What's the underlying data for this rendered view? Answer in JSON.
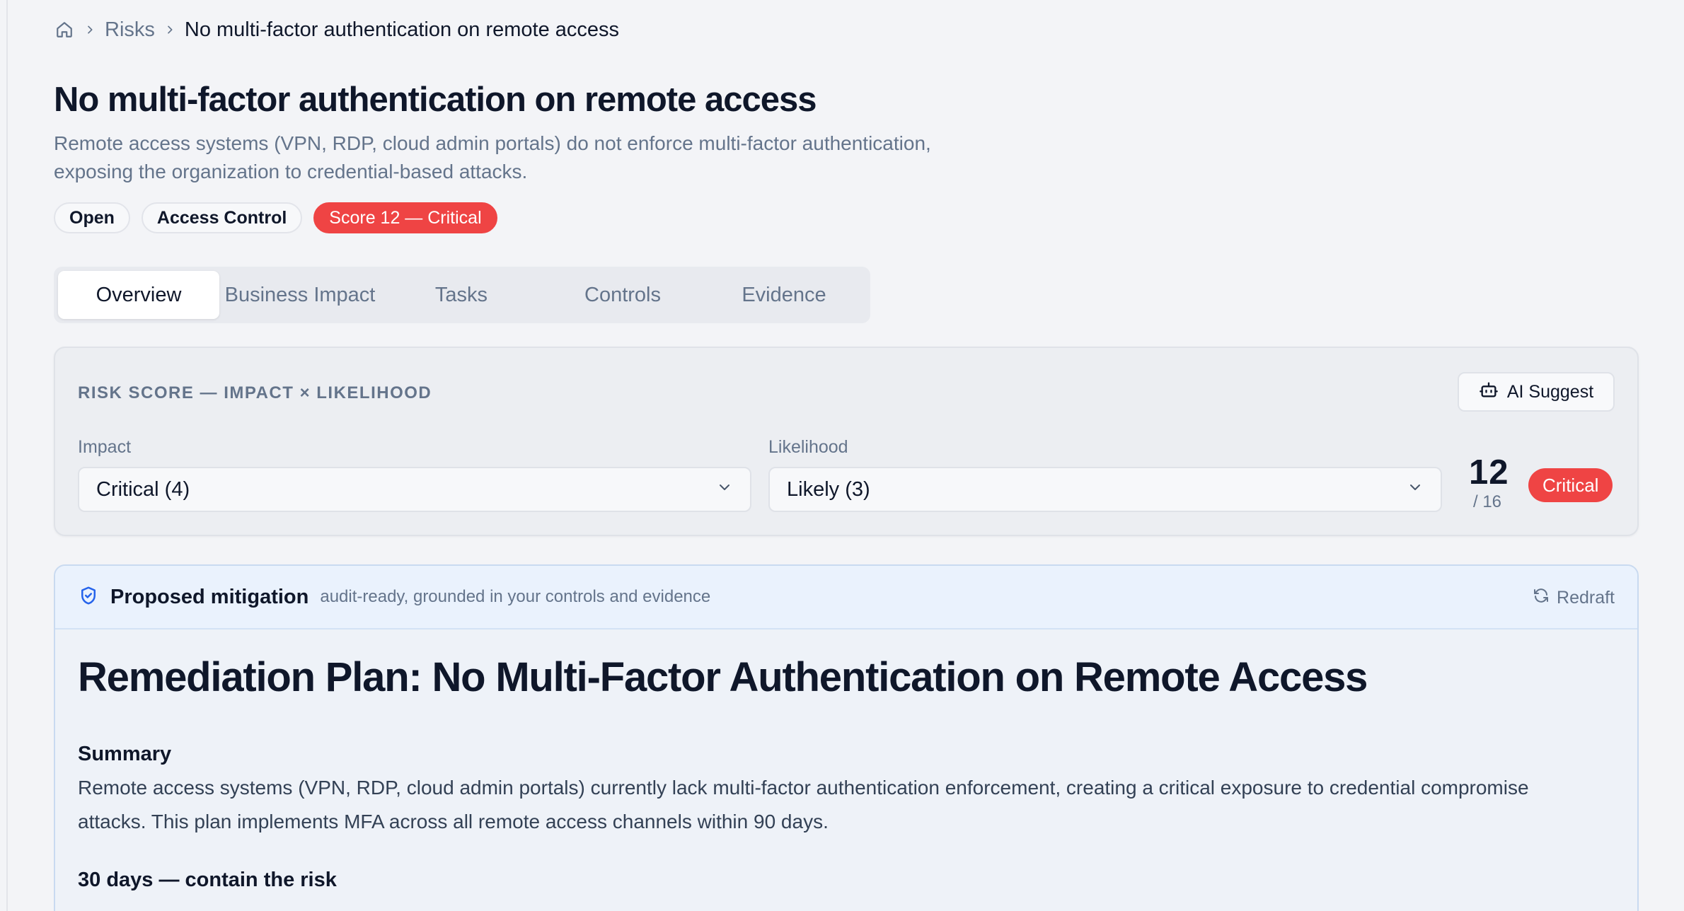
{
  "breadcrumb": {
    "home_icon": "home-icon",
    "items": [
      "Risks"
    ],
    "current": "No multi-factor authentication on remote access"
  },
  "risk": {
    "title": "No multi-factor authentication on remote access",
    "description": "Remote access systems (VPN, RDP, cloud admin portals) do not enforce multi-factor authentication, exposing the organization to credential-based attacks.",
    "badges": {
      "status": "Open",
      "category": "Access Control",
      "score": "Score 12 — Critical"
    }
  },
  "tabs": [
    "Overview",
    "Business Impact",
    "Tasks",
    "Controls",
    "Evidence"
  ],
  "active_tab": "Overview",
  "score_card": {
    "heading": "RISK SCORE — IMPACT × LIKELIHOOD",
    "ai_button": "AI Suggest",
    "impact_label": "Impact",
    "impact_value": "Critical (4)",
    "likelihood_label": "Likelihood",
    "likelihood_value": "Likely (3)",
    "score": "12",
    "score_max": "/ 16",
    "severity": "Critical"
  },
  "mitigation": {
    "title": "Proposed mitigation",
    "subtitle": "audit-ready, grounded in your controls and evidence",
    "redraft": "Redraft",
    "plan_title": "Remediation Plan: No Multi-Factor Authentication on Remote Access",
    "summary_heading": "Summary",
    "summary_text": "Remote access systems (VPN, RDP, cloud admin portals) currently lack multi-factor authentication enforcement, creating a critical exposure to credential compromise attacks. This plan implements MFA across all remote access channels within 90 days.",
    "phase1_heading": "30 days — contain the risk"
  },
  "colors": {
    "critical": "#ef4444",
    "accent_blue": "#2563eb",
    "muted_text": "#64748b"
  }
}
